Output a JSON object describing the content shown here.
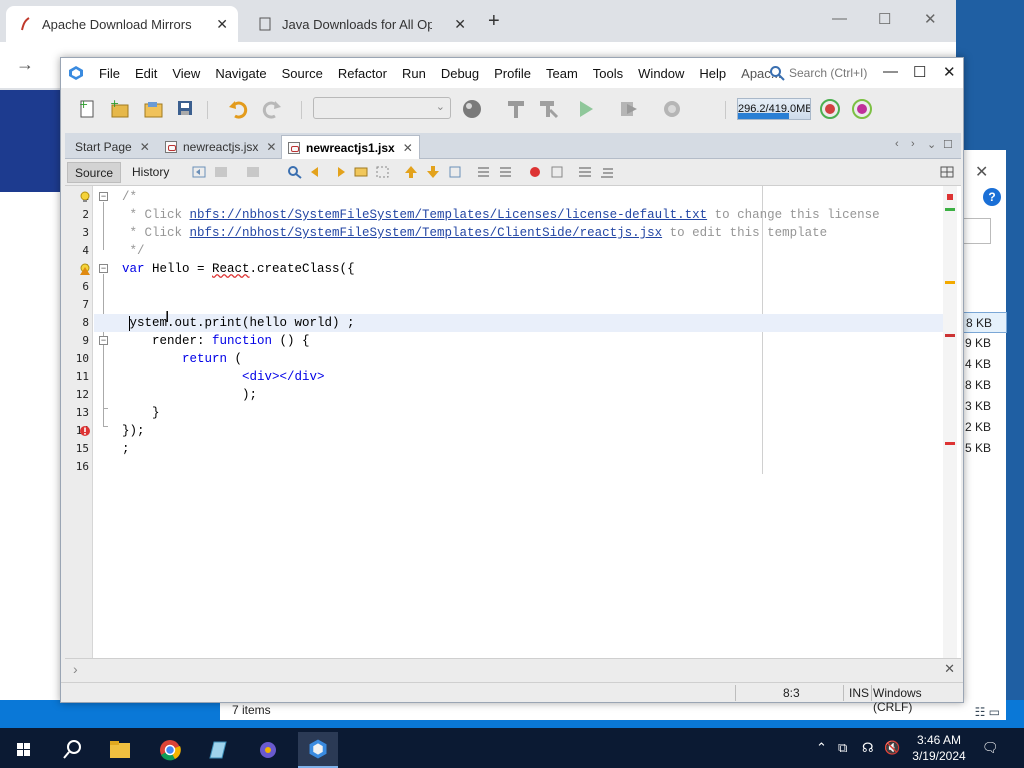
{
  "browser": {
    "tabs": [
      {
        "title": "Apache Download Mirrors",
        "active": true
      },
      {
        "title": "Java Downloads for All Operati",
        "active": false
      }
    ]
  },
  "explorer": {
    "sizes": [
      "8 KB",
      "9 KB",
      "4 KB",
      "8 KB",
      "3 KB",
      "2 KB",
      "5 KB"
    ],
    "items_count": "7 items"
  },
  "ide": {
    "menu": [
      "File",
      "Edit",
      "View",
      "Navigate",
      "Source",
      "Refactor",
      "Run",
      "Debug",
      "Profile",
      "Team",
      "Tools",
      "Window",
      "Help",
      "Apac..."
    ],
    "search_placeholder": "Search (Ctrl+I)",
    "memory": {
      "label": "296.2/419.0MB",
      "used_fraction": 0.71
    },
    "tabs": [
      {
        "label": "Start Page",
        "active": false
      },
      {
        "label": "newreactjs.jsx",
        "active": false
      },
      {
        "label": "newreactjs1.jsx",
        "active": true
      }
    ],
    "editor_modes": {
      "source": "Source",
      "history": "History"
    },
    "line_numbers": [
      "1",
      "2",
      "3",
      "4",
      "5",
      "6",
      "7",
      "8",
      "9",
      "10",
      "11",
      "12",
      "13",
      "14",
      "15",
      "16"
    ],
    "code": {
      "l1": "/*",
      "l2_pre": " * Click ",
      "l2_link": "nbfs://nbhost/SystemFileSystem/Templates/Licenses/license-default.txt",
      "l2_post": " to change this license",
      "l3_pre": " * Click ",
      "l3_link": "nbfs://nbhost/SystemFileSystem/Templates/ClientSide/reactjs.jsx",
      "l3_post": " to edit this template",
      "l4": " */",
      "l5_kw": "var",
      "l5_name": " Hello = ",
      "l5_err": "React",
      "l5_rest": ".createClass({",
      "l8": "ystem.out.print(hello world) ;",
      "l9_name": "    render: ",
      "l9_kw": "function",
      "l9_rest": " () {",
      "l10_kw": "        return",
      "l10_rest": " (",
      "l11": "                <div></div>",
      "l12": "                );",
      "l13": "    }",
      "l14": "});",
      "l15": ";"
    },
    "status": {
      "position": "8:3",
      "mode": "INS",
      "eol": "Windows (CRLF)"
    }
  },
  "taskbar": {
    "time": "3:46 AM",
    "date": "3/19/2024"
  },
  "colors": {
    "ide_bg": "#ececec",
    "link": "#2346a4",
    "keyword": "#0000e6",
    "comment": "#969696",
    "taskbar": "#0b1a33"
  }
}
